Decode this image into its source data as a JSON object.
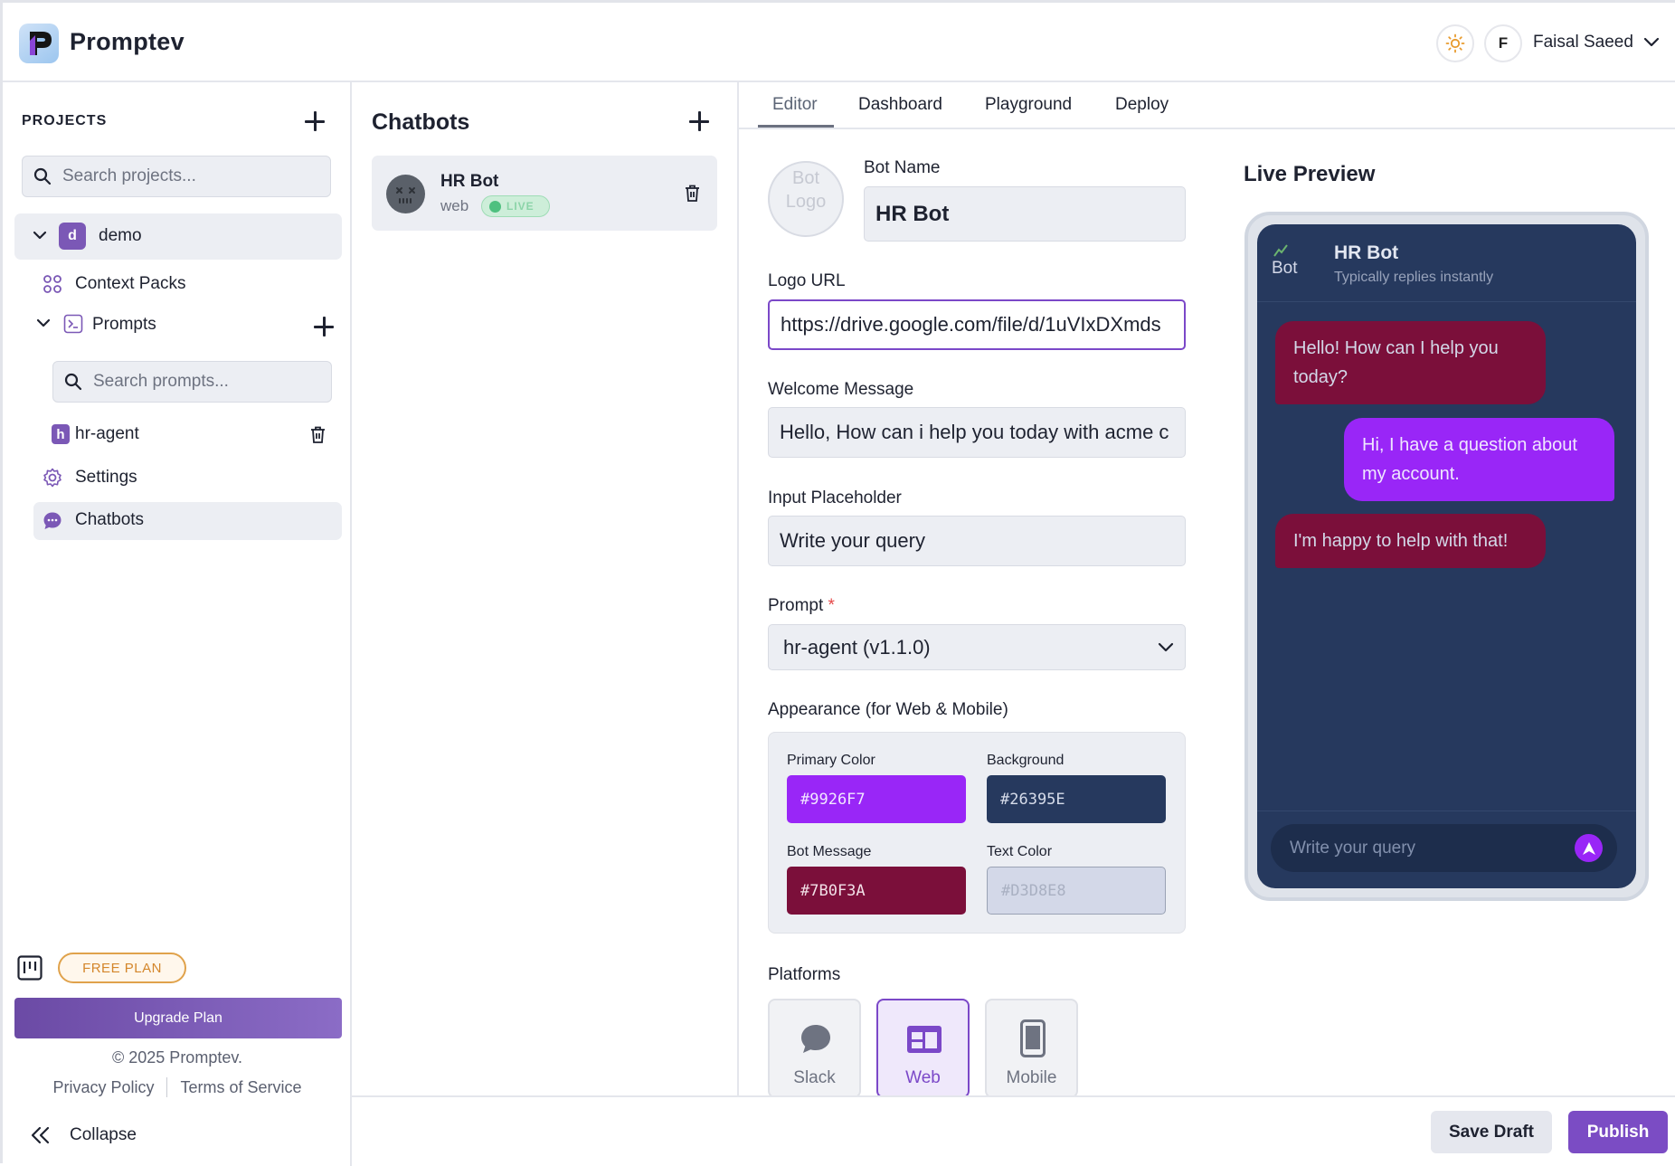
{
  "app": {
    "brand": "Promptev"
  },
  "header": {
    "avatar_initial": "F",
    "user_name": "Faisal Saeed"
  },
  "sidebar": {
    "projects_heading": "PROJECTS",
    "search_projects_placeholder": "Search projects...",
    "project": {
      "badge": "d",
      "name": "demo"
    },
    "context_packs": "Context Packs",
    "prompts": "Prompts",
    "search_prompts_placeholder": "Search prompts...",
    "prompt_item": {
      "badge": "h",
      "name": "hr-agent"
    },
    "settings": "Settings",
    "chatbots": "Chatbots",
    "plan_badge": "FREE PLAN",
    "upgrade_label": "Upgrade Plan",
    "copyright": "© 2025 Promptev.",
    "privacy": "Privacy Policy",
    "terms": "Terms of Service",
    "collapse": "Collapse"
  },
  "chatbots_panel": {
    "title": "Chatbots",
    "bot": {
      "name": "HR Bot",
      "platform": "web",
      "status": "LIVE"
    }
  },
  "tabs": [
    "Editor",
    "Dashboard",
    "Playground",
    "Deploy"
  ],
  "active_tab": "Editor",
  "editor": {
    "logo_alt": "Bot Logo",
    "bot_name_label": "Bot Name",
    "bot_name_value": "HR Bot",
    "logo_url_label": "Logo URL",
    "logo_url_value": "https://drive.google.com/file/d/1uVIxDXmds",
    "welcome_label": "Welcome Message",
    "welcome_value": "Hello, How can i help you today with acme c",
    "placeholder_label": "Input Placeholder",
    "placeholder_value": "Write your query",
    "prompt_label": "Prompt",
    "prompt_required": "*",
    "prompt_value": "hr-agent (v1.1.0)",
    "appearance_label": "Appearance (for Web & Mobile)",
    "colors": {
      "primary_label": "Primary Color",
      "primary": "#9926F7",
      "background_label": "Background",
      "background": "#26395E",
      "bot_message_label": "Bot Message",
      "bot_message": "#7B0F3A",
      "text_color_label": "Text Color",
      "text_color": "#D3D8E8"
    },
    "platforms_label": "Platforms",
    "platforms": [
      {
        "name": "Slack",
        "selected": false
      },
      {
        "name": "Web",
        "selected": true
      },
      {
        "name": "Mobile",
        "selected": false
      }
    ]
  },
  "preview": {
    "title": "Live Preview",
    "logo_alt": "Bot",
    "bot_name": "HR Bot",
    "subtitle": "Typically replies instantly",
    "messages": [
      {
        "from": "bot",
        "text": "Hello! How can I help you today?"
      },
      {
        "from": "user",
        "text": "Hi, I have a question about my account."
      },
      {
        "from": "bot",
        "text": "I'm happy to help with that!"
      }
    ],
    "input_placeholder": "Write your query"
  },
  "footer": {
    "save_draft": "Save Draft",
    "publish": "Publish"
  }
}
